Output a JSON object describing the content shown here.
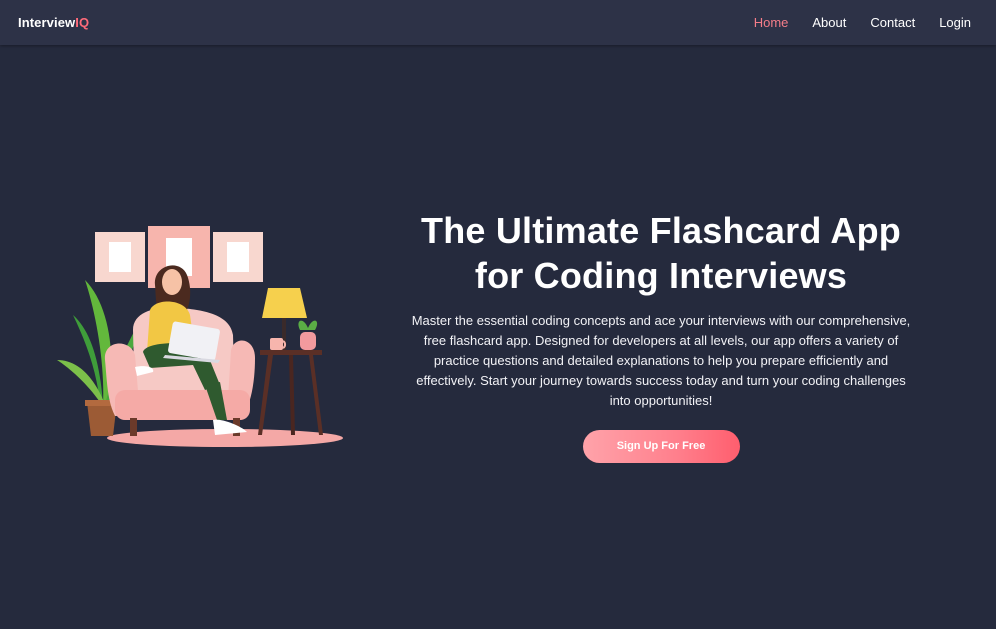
{
  "brand": {
    "main": "Interview",
    "accent": "IQ"
  },
  "nav": {
    "items": [
      {
        "label": "Home",
        "active": true
      },
      {
        "label": "About",
        "active": false
      },
      {
        "label": "Contact",
        "active": false
      },
      {
        "label": "Login",
        "active": false
      }
    ]
  },
  "hero": {
    "title_line1": "The Ultimate Flashcard App",
    "title_line2": "for Coding Interviews",
    "description": "Master the essential coding concepts and ace your interviews with our comprehensive, free flashcard app. Designed for developers at all levels, our app offers a variety of practice questions and detailed explanations to help you prepare efficiently and effectively. Start your journey towards success today and turn your coding challenges into opportunities!",
    "cta_label": "Sign Up For Free"
  },
  "colors": {
    "background": "#252a3d",
    "navbar": "#2d3247",
    "accent": "#ff6b7a",
    "active_link": "#f47d89"
  },
  "illustration": {
    "icon": "woman-on-armchair-with-laptop-illustration"
  }
}
